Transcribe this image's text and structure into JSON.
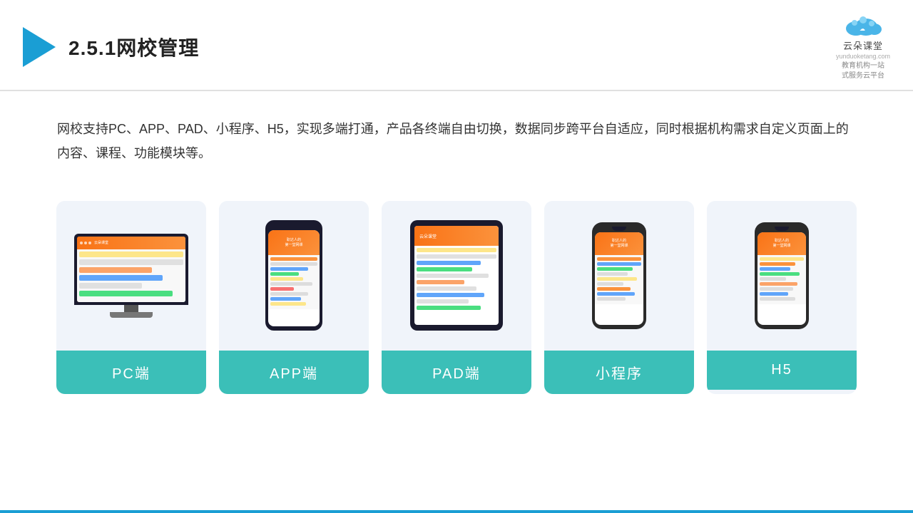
{
  "header": {
    "title": "2.5.1网校管理",
    "brand": {
      "name": "云朵课堂",
      "url": "yunduoketang.com",
      "tagline": "教育机构一站\n式服务云平台"
    }
  },
  "description": "网校支持PC、APP、PAD、小程序、H5，实现多端打通，产品各终端自由切换，数据同步跨平台自适应，同时根据机构需求自定义页面上的内容、课程、功能模块等。",
  "cards": [
    {
      "id": "pc",
      "label": "PC端"
    },
    {
      "id": "app",
      "label": "APP端"
    },
    {
      "id": "pad",
      "label": "PAD端"
    },
    {
      "id": "miniapp",
      "label": "小程序"
    },
    {
      "id": "h5",
      "label": "H5"
    }
  ]
}
